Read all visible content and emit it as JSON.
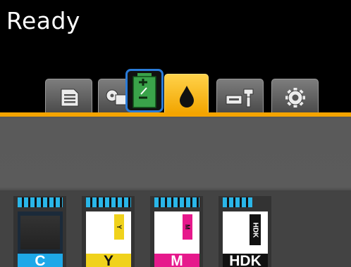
{
  "status": {
    "text": "Ready"
  },
  "tabs": [
    {
      "name": "print-queue",
      "icon": "document-list-icon",
      "active": false
    },
    {
      "name": "paper",
      "icon": "paper-roll-icon",
      "active": false
    },
    {
      "name": "ink",
      "icon": "ink-drop-icon",
      "active": true
    },
    {
      "name": "maintenance",
      "icon": "printer-wrench-icon",
      "active": false
    },
    {
      "name": "setup",
      "icon": "gear-icon",
      "active": false
    }
  ],
  "overlay_icon": {
    "icon": "battery-plus-minus-icon",
    "highlighted": true
  },
  "colors": {
    "accent": "#f4a400",
    "level": "#2ab6e8",
    "highlight_border": "#2a7bd8"
  },
  "inks": [
    {
      "label": "C",
      "tag": "",
      "color": "#1ea8e8",
      "label_color": "#ffffff",
      "level": 1.0
    },
    {
      "label": "Y",
      "tag": "Y",
      "color": "#f0d21c",
      "label_color": "#111111",
      "level": 1.0
    },
    {
      "label": "M",
      "tag": "M",
      "color": "#e6198c",
      "label_color": "#ffffff",
      "level": 1.0
    },
    {
      "label": "HDK",
      "tag": "HDK",
      "color": "#111111",
      "label_color": "#ffffff",
      "level": 0.65
    }
  ]
}
